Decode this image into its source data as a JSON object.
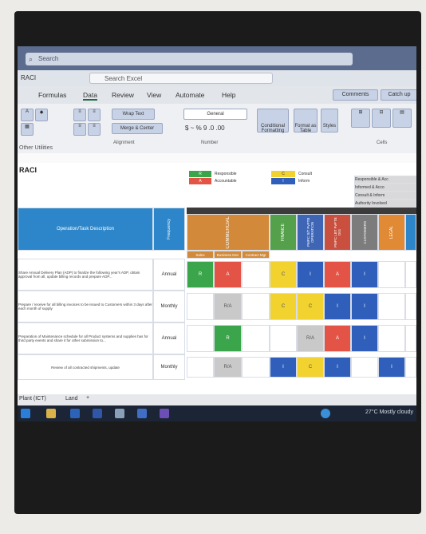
{
  "window": {
    "search_placeholder": "Search",
    "file_title": "RACI",
    "search_box": "Search Excel"
  },
  "tabs": [
    "Formulas",
    "Data",
    "Review",
    "View",
    "Automate",
    "Help"
  ],
  "ribbon": {
    "wrap_text": "Wrap Text",
    "merge_center": "Merge & Center",
    "number_format": "General",
    "conditional_formatting": "Conditional Formatting",
    "format_as_table": "Format as Table",
    "cell_styles": "Styles",
    "comments": "Comments",
    "catch_up": "Catch up",
    "alignment_group": "Alignment",
    "number_group": "Number",
    "cells_group": "Cells",
    "other_utilities": "Other Utilities"
  },
  "sheet": {
    "title_fragment": "RACI",
    "legend": {
      "r_code": "R",
      "r_text": "Responsible",
      "a_code": "A",
      "a_text": "Accountable",
      "c_code": "C",
      "c_text": "Consult",
      "i_code": "I",
      "i_text": "Inform"
    },
    "right_legend": [
      "Responsible & Acc",
      "Informed & Acco",
      "Consult & Inform",
      "Authority Involved"
    ],
    "header_desc": "Operation/Task Description",
    "header_freq": "Frequency",
    "columns": [
      "COMMERCIAL",
      "FINANCE",
      "PMPC S/T PvPTB OPERATION",
      "PMPC LBT PvPTB DIG",
      "CUSTOMERS",
      "LEGAL"
    ],
    "subcolumns": [
      "Sales",
      "Business Dev",
      "Contract Mgt"
    ],
    "rows": [
      {
        "desc": "Share Annual Delivery Plan (ADP) to finalize the following year's ADP, obtain approval from all, update billing records and prepare ADP...",
        "freq": "Annual"
      },
      {
        "desc": "Prepare / receive for all billing invoices to be issued to Customers within 3 days after each month of supply",
        "freq": "Monthly"
      },
      {
        "desc": "Preparation of Maintenance schedule for all Product systems and supplies has for third party events and share it for other submission to...",
        "freq": "Annual"
      },
      {
        "desc": "Review of all contracted shipments, update",
        "freq": "Monthly"
      }
    ]
  },
  "raci_grid": [
    [
      "R",
      "A",
      "",
      "C",
      "I",
      "A",
      "I",
      "",
      ""
    ],
    [
      "",
      "R/A",
      "",
      "C",
      "C",
      "I",
      "I",
      "",
      ""
    ],
    [
      "",
      "R",
      "",
      "",
      "R/A",
      "A",
      "I",
      "",
      ""
    ],
    [
      "",
      "R/A",
      "",
      "I",
      "C",
      "I",
      "",
      "I",
      ""
    ]
  ],
  "colors": {
    "r": "#3aa54a",
    "a": "#e45446",
    "c": "#f2d22e",
    "i": "#2f5fba",
    "ra": "#c9c9c9",
    "header_blue": "#2d86c9",
    "commercial": "#d28a3a",
    "finance": "#55a04a",
    "ops": "#3f65b5",
    "dig": "#c9503e",
    "customers": "#7c7c7c",
    "legal": "#e08a35"
  },
  "sheet_tabs": [
    "Plant (ICT)",
    "Land"
  ],
  "tray": {
    "weather": "27°C  Mostly cloudy"
  }
}
